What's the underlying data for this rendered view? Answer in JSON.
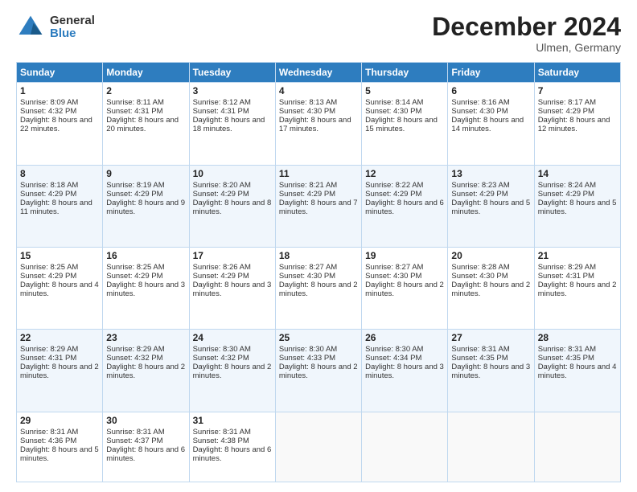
{
  "logo": {
    "general": "General",
    "blue": "Blue"
  },
  "header": {
    "month": "December 2024",
    "location": "Ulmen, Germany"
  },
  "days": [
    "Sunday",
    "Monday",
    "Tuesday",
    "Wednesday",
    "Thursday",
    "Friday",
    "Saturday"
  ],
  "weeks": [
    [
      {
        "day": "1",
        "sunrise": "8:09 AM",
        "sunset": "4:32 PM",
        "daylight": "8 hours and 22 minutes."
      },
      {
        "day": "2",
        "sunrise": "8:11 AM",
        "sunset": "4:31 PM",
        "daylight": "8 hours and 20 minutes."
      },
      {
        "day": "3",
        "sunrise": "8:12 AM",
        "sunset": "4:31 PM",
        "daylight": "8 hours and 18 minutes."
      },
      {
        "day": "4",
        "sunrise": "8:13 AM",
        "sunset": "4:30 PM",
        "daylight": "8 hours and 17 minutes."
      },
      {
        "day": "5",
        "sunrise": "8:14 AM",
        "sunset": "4:30 PM",
        "daylight": "8 hours and 15 minutes."
      },
      {
        "day": "6",
        "sunrise": "8:16 AM",
        "sunset": "4:30 PM",
        "daylight": "8 hours and 14 minutes."
      },
      {
        "day": "7",
        "sunrise": "8:17 AM",
        "sunset": "4:29 PM",
        "daylight": "8 hours and 12 minutes."
      }
    ],
    [
      {
        "day": "8",
        "sunrise": "8:18 AM",
        "sunset": "4:29 PM",
        "daylight": "8 hours and 11 minutes."
      },
      {
        "day": "9",
        "sunrise": "8:19 AM",
        "sunset": "4:29 PM",
        "daylight": "8 hours and 9 minutes."
      },
      {
        "day": "10",
        "sunrise": "8:20 AM",
        "sunset": "4:29 PM",
        "daylight": "8 hours and 8 minutes."
      },
      {
        "day": "11",
        "sunrise": "8:21 AM",
        "sunset": "4:29 PM",
        "daylight": "8 hours and 7 minutes."
      },
      {
        "day": "12",
        "sunrise": "8:22 AM",
        "sunset": "4:29 PM",
        "daylight": "8 hours and 6 minutes."
      },
      {
        "day": "13",
        "sunrise": "8:23 AM",
        "sunset": "4:29 PM",
        "daylight": "8 hours and 5 minutes."
      },
      {
        "day": "14",
        "sunrise": "8:24 AM",
        "sunset": "4:29 PM",
        "daylight": "8 hours and 5 minutes."
      }
    ],
    [
      {
        "day": "15",
        "sunrise": "8:25 AM",
        "sunset": "4:29 PM",
        "daylight": "8 hours and 4 minutes."
      },
      {
        "day": "16",
        "sunrise": "8:25 AM",
        "sunset": "4:29 PM",
        "daylight": "8 hours and 3 minutes."
      },
      {
        "day": "17",
        "sunrise": "8:26 AM",
        "sunset": "4:29 PM",
        "daylight": "8 hours and 3 minutes."
      },
      {
        "day": "18",
        "sunrise": "8:27 AM",
        "sunset": "4:30 PM",
        "daylight": "8 hours and 2 minutes."
      },
      {
        "day": "19",
        "sunrise": "8:27 AM",
        "sunset": "4:30 PM",
        "daylight": "8 hours and 2 minutes."
      },
      {
        "day": "20",
        "sunrise": "8:28 AM",
        "sunset": "4:30 PM",
        "daylight": "8 hours and 2 minutes."
      },
      {
        "day": "21",
        "sunrise": "8:29 AM",
        "sunset": "4:31 PM",
        "daylight": "8 hours and 2 minutes."
      }
    ],
    [
      {
        "day": "22",
        "sunrise": "8:29 AM",
        "sunset": "4:31 PM",
        "daylight": "8 hours and 2 minutes."
      },
      {
        "day": "23",
        "sunrise": "8:29 AM",
        "sunset": "4:32 PM",
        "daylight": "8 hours and 2 minutes."
      },
      {
        "day": "24",
        "sunrise": "8:30 AM",
        "sunset": "4:32 PM",
        "daylight": "8 hours and 2 minutes."
      },
      {
        "day": "25",
        "sunrise": "8:30 AM",
        "sunset": "4:33 PM",
        "daylight": "8 hours and 2 minutes."
      },
      {
        "day": "26",
        "sunrise": "8:30 AM",
        "sunset": "4:34 PM",
        "daylight": "8 hours and 3 minutes."
      },
      {
        "day": "27",
        "sunrise": "8:31 AM",
        "sunset": "4:35 PM",
        "daylight": "8 hours and 3 minutes."
      },
      {
        "day": "28",
        "sunrise": "8:31 AM",
        "sunset": "4:35 PM",
        "daylight": "8 hours and 4 minutes."
      }
    ],
    [
      {
        "day": "29",
        "sunrise": "8:31 AM",
        "sunset": "4:36 PM",
        "daylight": "8 hours and 5 minutes."
      },
      {
        "day": "30",
        "sunrise": "8:31 AM",
        "sunset": "4:37 PM",
        "daylight": "8 hours and 6 minutes."
      },
      {
        "day": "31",
        "sunrise": "8:31 AM",
        "sunset": "4:38 PM",
        "daylight": "8 hours and 6 minutes."
      },
      null,
      null,
      null,
      null
    ]
  ],
  "labels": {
    "sunrise": "Sunrise:",
    "sunset": "Sunset:",
    "daylight": "Daylight:"
  }
}
